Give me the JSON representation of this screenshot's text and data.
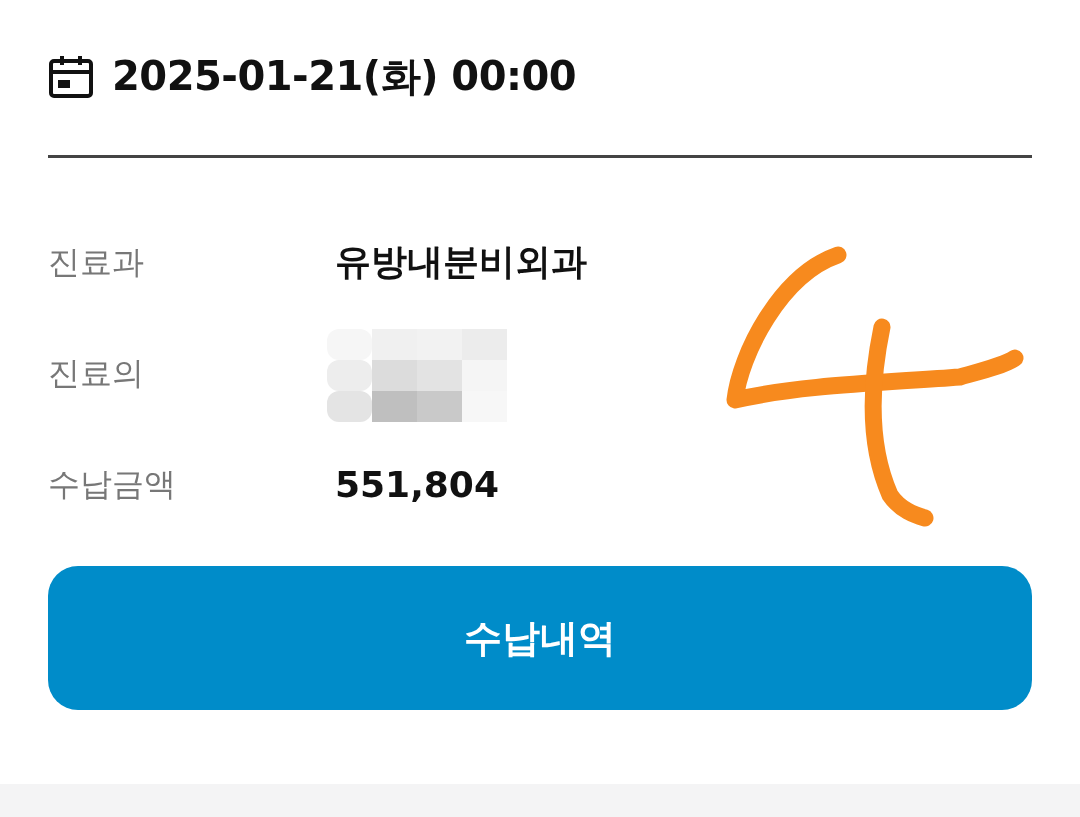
{
  "date": "2025-01-21(화) 00:00",
  "details": [
    {
      "label": "진료과",
      "kind": "text",
      "value": "유방내분비외과"
    },
    {
      "label": "진료의",
      "kind": "redacted"
    },
    {
      "label": "수납금액",
      "kind": "text",
      "value": "551,804"
    }
  ],
  "button": "수납내역"
}
